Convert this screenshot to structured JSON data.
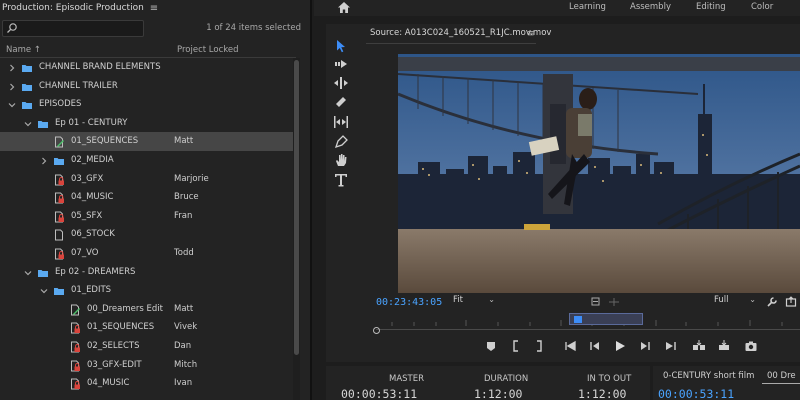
{
  "project": {
    "title": "Production: Episodic Production",
    "menu_icon": "hamburger-icon",
    "search_placeholder": "",
    "items_selected": "1 of 24 items selected",
    "columns": {
      "name": "Name",
      "locked": "Project Locked"
    },
    "rows": [
      {
        "label": "CHANNEL BRAND ELEMENTS",
        "type": "bin",
        "depth": 0,
        "twist": "closed",
        "locked": ""
      },
      {
        "label": "CHANNEL TRAILER",
        "type": "bin",
        "depth": 0,
        "twist": "closed",
        "locked": ""
      },
      {
        "label": "EPISODES",
        "type": "bin",
        "depth": 0,
        "twist": "open",
        "locked": ""
      },
      {
        "label": "Ep 01 - CENTURY",
        "type": "bin",
        "depth": 1,
        "twist": "open",
        "locked": ""
      },
      {
        "label": "01_SEQUENCES",
        "type": "project-edit",
        "depth": 2,
        "twist": "",
        "locked": "Matt",
        "selected": true
      },
      {
        "label": "02_MEDIA",
        "type": "bin",
        "depth": 2,
        "twist": "closed",
        "locked": ""
      },
      {
        "label": "03_GFX",
        "type": "project-locked",
        "depth": 2,
        "twist": "",
        "locked": "Marjorie"
      },
      {
        "label": "04_MUSIC",
        "type": "project-locked",
        "depth": 2,
        "twist": "",
        "locked": "Bruce"
      },
      {
        "label": "05_SFX",
        "type": "project-locked",
        "depth": 2,
        "twist": "",
        "locked": "Fran"
      },
      {
        "label": "06_STOCK",
        "type": "project",
        "depth": 2,
        "twist": "",
        "locked": ""
      },
      {
        "label": "07_VO",
        "type": "project-locked",
        "depth": 2,
        "twist": "",
        "locked": "Todd"
      },
      {
        "label": "Ep 02 - DREAMERS",
        "type": "bin",
        "depth": 1,
        "twist": "open",
        "locked": ""
      },
      {
        "label": "01_EDITS",
        "type": "bin",
        "depth": 2,
        "twist": "open",
        "locked": ""
      },
      {
        "label": "00_Dreamers Edit",
        "type": "project-edit",
        "depth": 3,
        "twist": "",
        "locked": "Matt"
      },
      {
        "label": "01_SEQUENCES",
        "type": "project-locked",
        "depth": 3,
        "twist": "",
        "locked": "Vivek"
      },
      {
        "label": "02_SELECTS",
        "type": "project-locked",
        "depth": 3,
        "twist": "",
        "locked": "Dan"
      },
      {
        "label": "03_GFX-EDIT",
        "type": "project-locked",
        "depth": 3,
        "twist": "",
        "locked": "Mitch"
      },
      {
        "label": "04_MUSIC",
        "type": "project-locked",
        "depth": 3,
        "twist": "",
        "locked": "Ivan"
      }
    ]
  },
  "workspaces": {
    "home_icon": "home-icon",
    "tabs": [
      "Learning",
      "Assembly",
      "Editing",
      "Color"
    ]
  },
  "source": {
    "title": "Source: A013C024_160521_R1JC.mov.mov",
    "timecode": "00:23:43:05",
    "fit": "Fit",
    "resolution": "Full"
  },
  "bottom": {
    "master_label": "MASTER",
    "master_value": "00:00:53:11",
    "duration_label": "DURATION",
    "duration_value": "1:12:00",
    "inout_label": "IN TO OUT",
    "inout_value": "1:12:00",
    "timeline_tab1": "0-CENTURY short film",
    "timeline_tab2": "00 Dre",
    "timeline_timecode": "00:00:53:11"
  },
  "colors": {
    "accent": "#4aa3ff",
    "lock_red": "#d9443c",
    "folder_blue": "#5aa9f0"
  }
}
